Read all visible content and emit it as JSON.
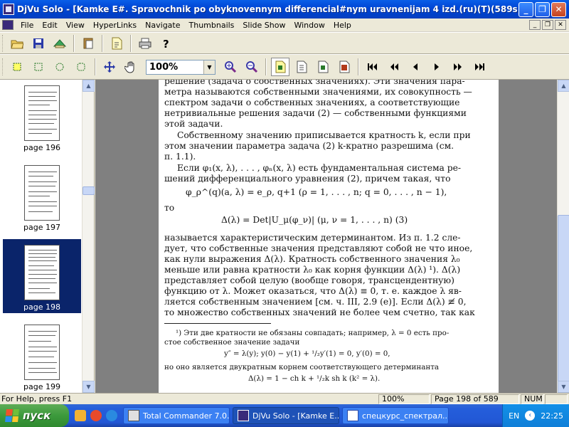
{
  "window": {
    "title": "DjVu Solo - [Kamke E#. Spravochnik po obyknovennym differencial#nym uravnenijam 4 izd.(ru)(T)(589s)]"
  },
  "menu": [
    "File",
    "Edit",
    "View",
    "HyperLinks",
    "Navigate",
    "Thumbnails",
    "Slide Show",
    "Window",
    "Help"
  ],
  "toolbar": {
    "zoom_value": "100%"
  },
  "thumbnails": [
    {
      "label": "page 196",
      "selected": false
    },
    {
      "label": "page 197",
      "selected": false
    },
    {
      "label": "page 198",
      "selected": true
    },
    {
      "label": "page 199",
      "selected": false
    }
  ],
  "document": {
    "lines": [
      "решение (задача о собственных значениях). Эти значения пара-",
      "метра называются собственными значениями, их совокупность —",
      "спектром задачи о собственных значениях, а соответствующие",
      "нетривиальные решения задачи (2) — собственными функциями",
      "этой задачи.",
      "Собственному значению приписывается кратность k, если при",
      "этом значении параметра задача (2) k-кратно разрешима (см.",
      "п. 1.1).",
      "Если φ₁(x, λ), . . . , φₙ(x, λ) есть фундаментальная система ре-",
      "шений дифференциального уравнения (2), причем такая, что",
      "φ_ρ^(q)(a, λ) = e_ρ, q+1       (ρ = 1, . . . , n;  q = 0, . . . , n − 1),",
      "то",
      "Δ(λ) = Det|U_μ(φ_ν)|        (μ, ν = 1, . . . , n)                (3)",
      "называется характеристическим детерминантом. Из п. 1.2 сле-",
      "дует, что собственные значения представляют собой не что иное,",
      "как нули выражения Δ(λ). Кратность собственного значения λ₀",
      "меньше или равна кратности λ₀ как корня функции Δ(λ) ¹). Δ(λ)",
      "представляет собой целую (вообще говоря, трансцендентную)",
      "функцию от λ. Может оказаться, что Δ(λ) ≡ 0, т. е. каждое λ яв-",
      "ляется собственным значением [см. ч. III, 2.9 (e)]. Если Δ(λ) ≢ 0,",
      "то множество собственных значений не более чем счетно, так как"
    ],
    "footnote": [
      "¹) Эти две кратности не обязаны совпадать; например, λ = 0 есть про-",
      "стое собственное значение задачи",
      "y″ = λ(y);    y(0) − y(1) + ¹/₂y′(1) = 0,    y′(0) = 0,",
      "но оно является двукратным корнем соответствующего детерминанта",
      "Δ(λ) = 1 − ch k + ¹/₂k sh k      (k² = λ)."
    ]
  },
  "statusbar": {
    "help": "For Help, press F1",
    "zoom": "100%",
    "page": "Page 198 of 589",
    "num": "NUM"
  },
  "taskbar": {
    "start": "пуск",
    "tasks": [
      "Total Commander 7.0...",
      "DjVu Solo - [Kamke E...",
      "спецкурс_спектрал..."
    ],
    "lang": "EN",
    "time": "22:25"
  }
}
